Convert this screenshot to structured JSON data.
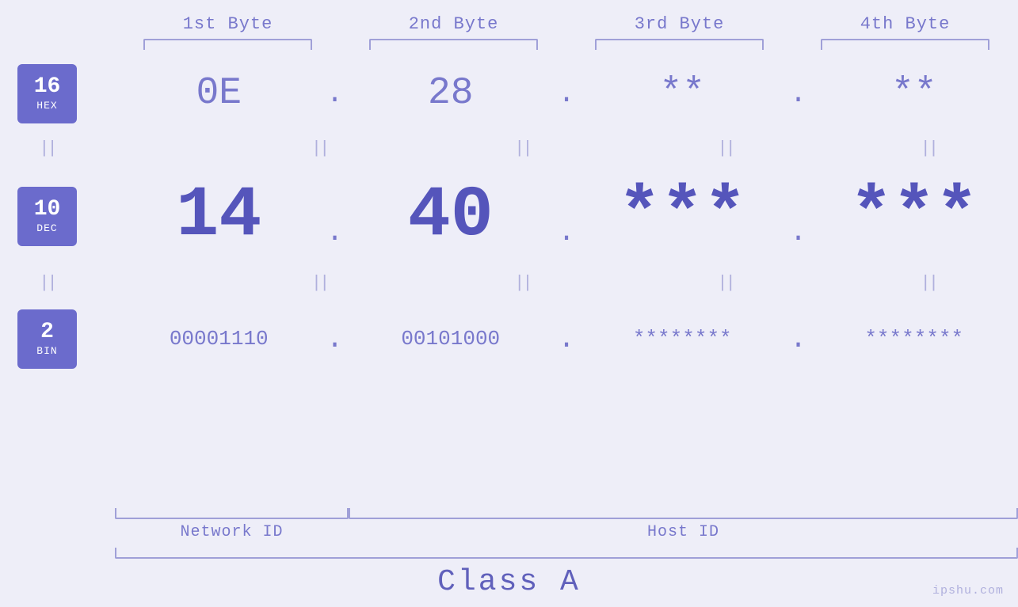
{
  "header": {
    "byte1_label": "1st Byte",
    "byte2_label": "2nd Byte",
    "byte3_label": "3rd Byte",
    "byte4_label": "4th Byte"
  },
  "badges": {
    "hex": {
      "number": "16",
      "label": "HEX"
    },
    "dec": {
      "number": "10",
      "label": "DEC"
    },
    "bin": {
      "number": "2",
      "label": "BIN"
    }
  },
  "hex_row": {
    "byte1": "0E",
    "byte2": "28",
    "byte3": "**",
    "byte4": "**",
    "dot": "."
  },
  "dec_row": {
    "byte1": "14",
    "byte2": "40",
    "byte3": "***",
    "byte4": "***",
    "dot": "."
  },
  "bin_row": {
    "byte1": "00001110",
    "byte2": "00101000",
    "byte3": "********",
    "byte4": "********",
    "dot": "."
  },
  "labels": {
    "network_id": "Network ID",
    "host_id": "Host ID",
    "class": "Class A"
  },
  "watermark": "ipshu.com"
}
